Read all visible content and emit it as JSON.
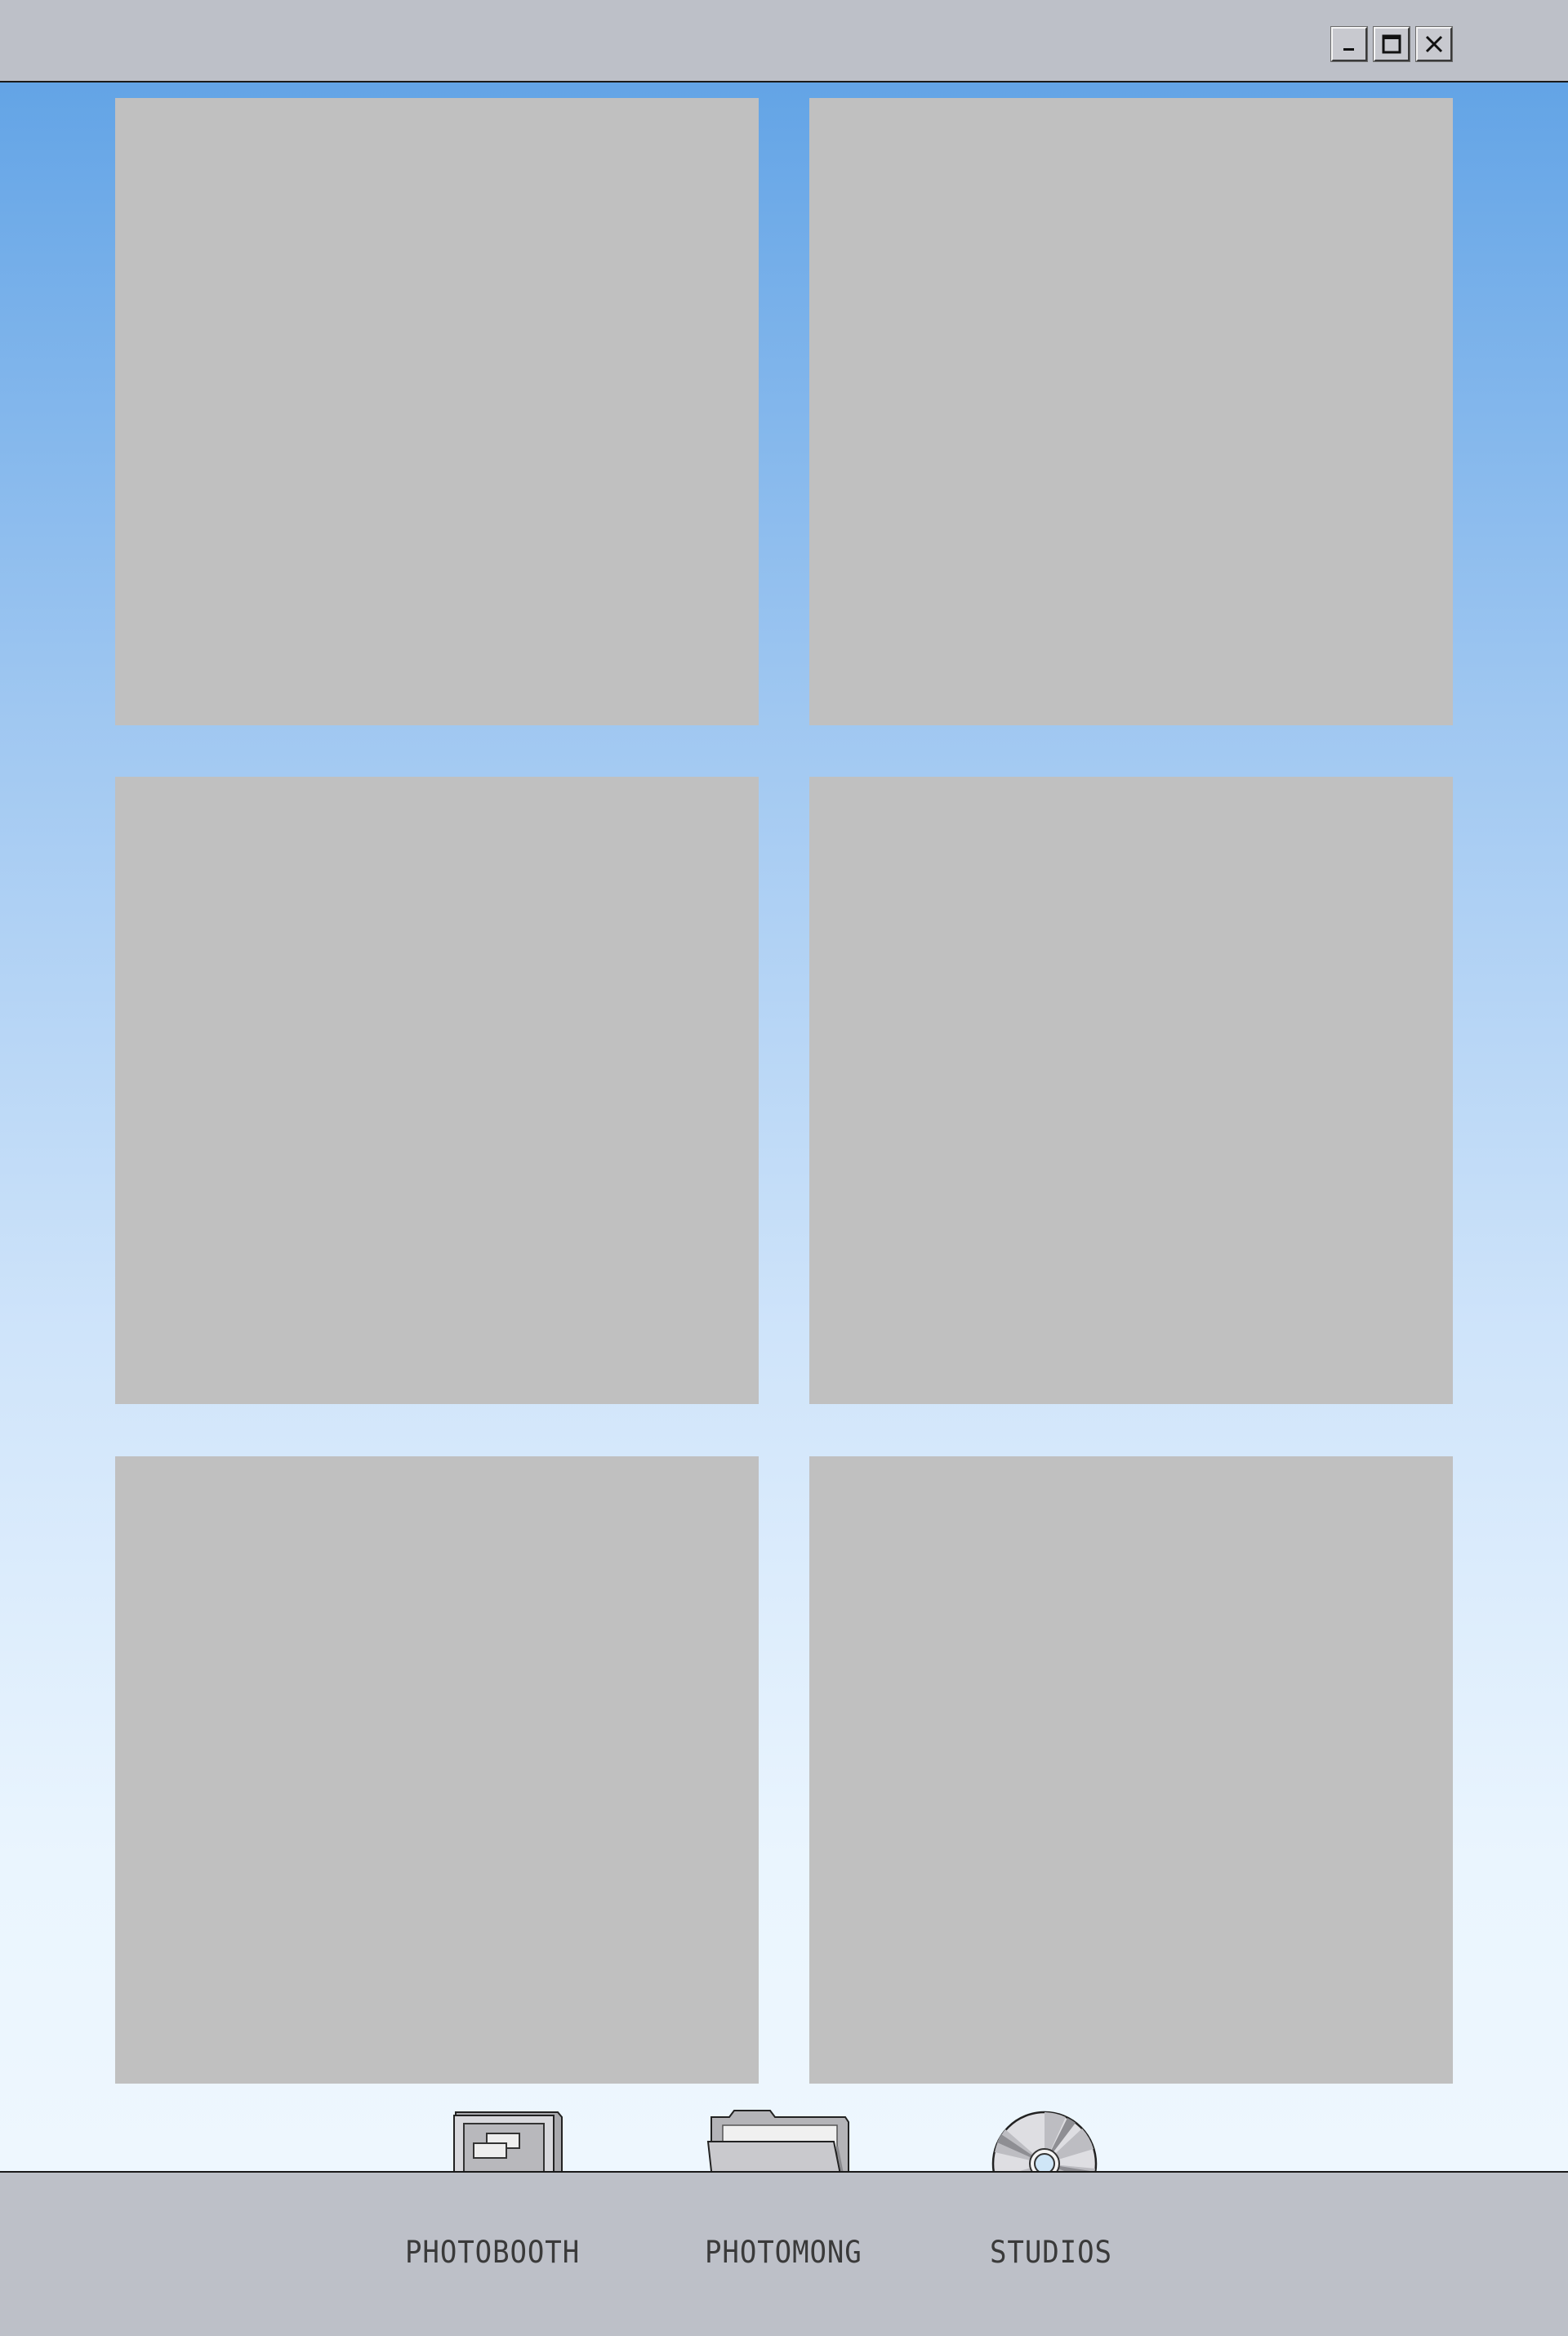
{
  "window": {
    "controls": [
      {
        "name": "minimize",
        "icon": "minimize-icon"
      },
      {
        "name": "maximize",
        "icon": "maximize-icon"
      },
      {
        "name": "close",
        "icon": "close-icon"
      }
    ]
  },
  "gallery": {
    "slot_count": 6,
    "slot_color": "#c0c0c0",
    "background_top": "#63a4e6",
    "background_bottom": "#eef7fe"
  },
  "dock": {
    "items": [
      {
        "label": "PHOTOBOOTH",
        "icon": "computer-icon"
      },
      {
        "label": "PHOTOMONG",
        "icon": "folder-icon"
      },
      {
        "label": "STUDIOS",
        "icon": "cd-disc-icon"
      }
    ]
  }
}
